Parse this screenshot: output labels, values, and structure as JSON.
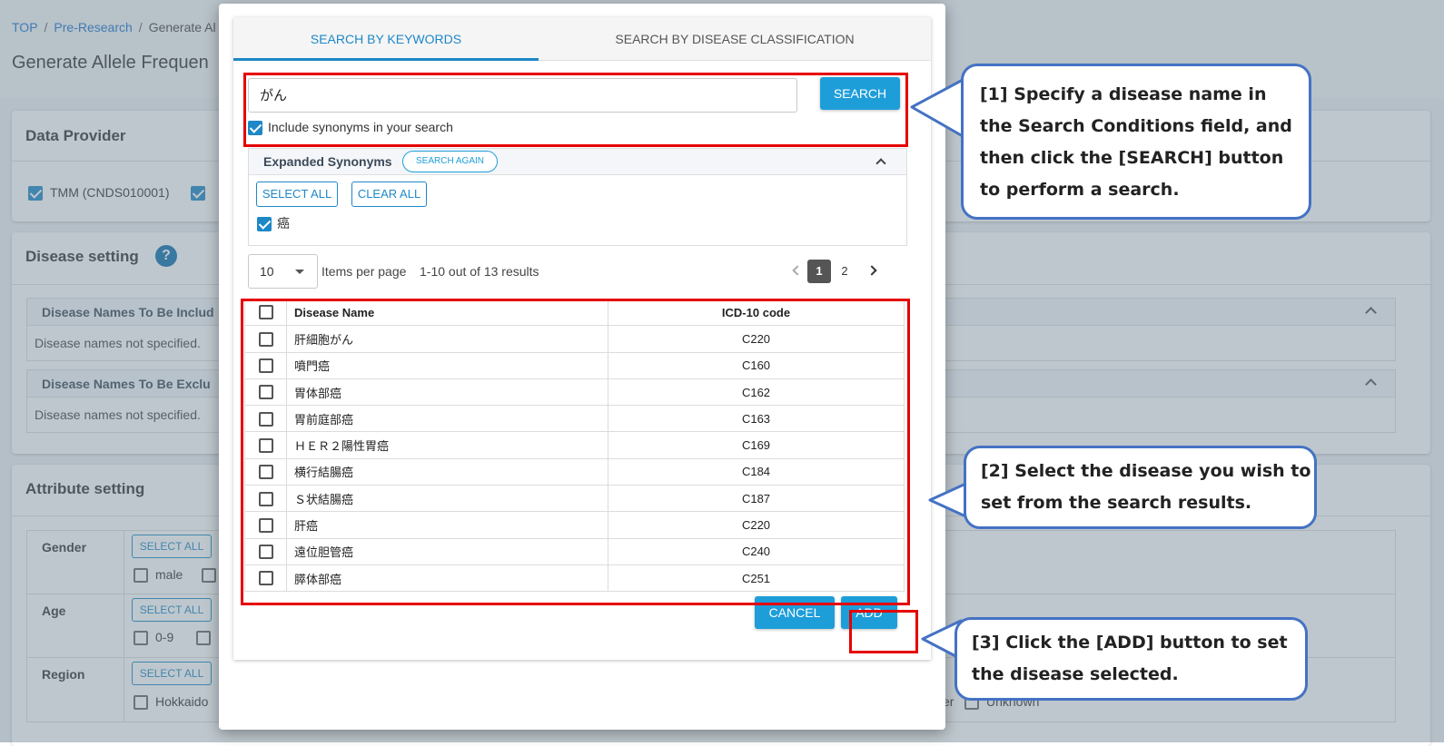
{
  "background": {
    "breadcrumb": [
      "TOP",
      "Pre-Research",
      "Generate Al"
    ],
    "page_title": "Generate Allele Frequen",
    "data_provider": {
      "title": "Data Provider",
      "options": [
        "TMM (CNDS010001)"
      ]
    },
    "disease_setting": {
      "title": "Disease setting",
      "help": "?",
      "include_title": "Disease Names To Be Includ",
      "exclude_title": "Disease Names To Be Exclu",
      "include_empty": "Disease names not specified.",
      "exclude_empty": "Disease names not specified."
    },
    "attribute_setting": {
      "title": "Attribute setting",
      "select_all": "SELECT ALL",
      "gender": {
        "label": "Gender",
        "option": "male"
      },
      "age": {
        "label": "Age",
        "option": "0-9"
      },
      "region": {
        "label": "Region",
        "option": "Hokkaido",
        "option_right_partial": "er",
        "option_right": "Unknown"
      }
    }
  },
  "modal": {
    "tabs": [
      "SEARCH BY KEYWORDS",
      "SEARCH BY DISEASE CLASSIFICATION"
    ],
    "active_tab": 0,
    "search": {
      "value": "がん",
      "button": "SEARCH"
    },
    "include_synonyms": {
      "label": "Include synonyms in your search",
      "checked": true
    },
    "synonyms": {
      "title": "Expanded Synonyms",
      "search_again": "SEARCH AGAIN",
      "select_all": "SELECT ALL",
      "clear_all": "CLEAR ALL",
      "terms": [
        "癌"
      ]
    },
    "pagination": {
      "per_page": "10",
      "per_page_label": "Items per page",
      "range": "1-10 out of 13 results",
      "pages": [
        "1",
        "2"
      ],
      "current_page": "1"
    },
    "table": {
      "headers": [
        "Disease Name",
        "ICD-10 code"
      ],
      "rows": [
        {
          "name": "肝細胞がん",
          "code": "C220"
        },
        {
          "name": "噴門癌",
          "code": "C160"
        },
        {
          "name": "胃体部癌",
          "code": "C162"
        },
        {
          "name": "胃前庭部癌",
          "code": "C163"
        },
        {
          "name": "ＨＥＲ２陽性胃癌",
          "code": "C169"
        },
        {
          "name": "横行結腸癌",
          "code": "C184"
        },
        {
          "name": "Ｓ状結腸癌",
          "code": "C187"
        },
        {
          "name": "肝癌",
          "code": "C220"
        },
        {
          "name": "遠位胆管癌",
          "code": "C240"
        },
        {
          "name": "膵体部癌",
          "code": "C251"
        }
      ]
    },
    "buttons": {
      "cancel": "CANCEL",
      "add": "ADD"
    }
  },
  "annotations": {
    "step1": [
      "[1] Specify a disease name in",
      "the Search Conditions field, and",
      "then click the [SEARCH] button",
      "to perform a search."
    ],
    "step2": [
      "[2] Select the disease you wish to",
      "set from the search results."
    ],
    "step3": [
      "[3] Click the [ADD] button to set",
      "the disease selected."
    ]
  },
  "colors": {
    "accent": "#1e9ed9",
    "annotation_red": "#e60000",
    "callout_blue": "#4472c4"
  }
}
